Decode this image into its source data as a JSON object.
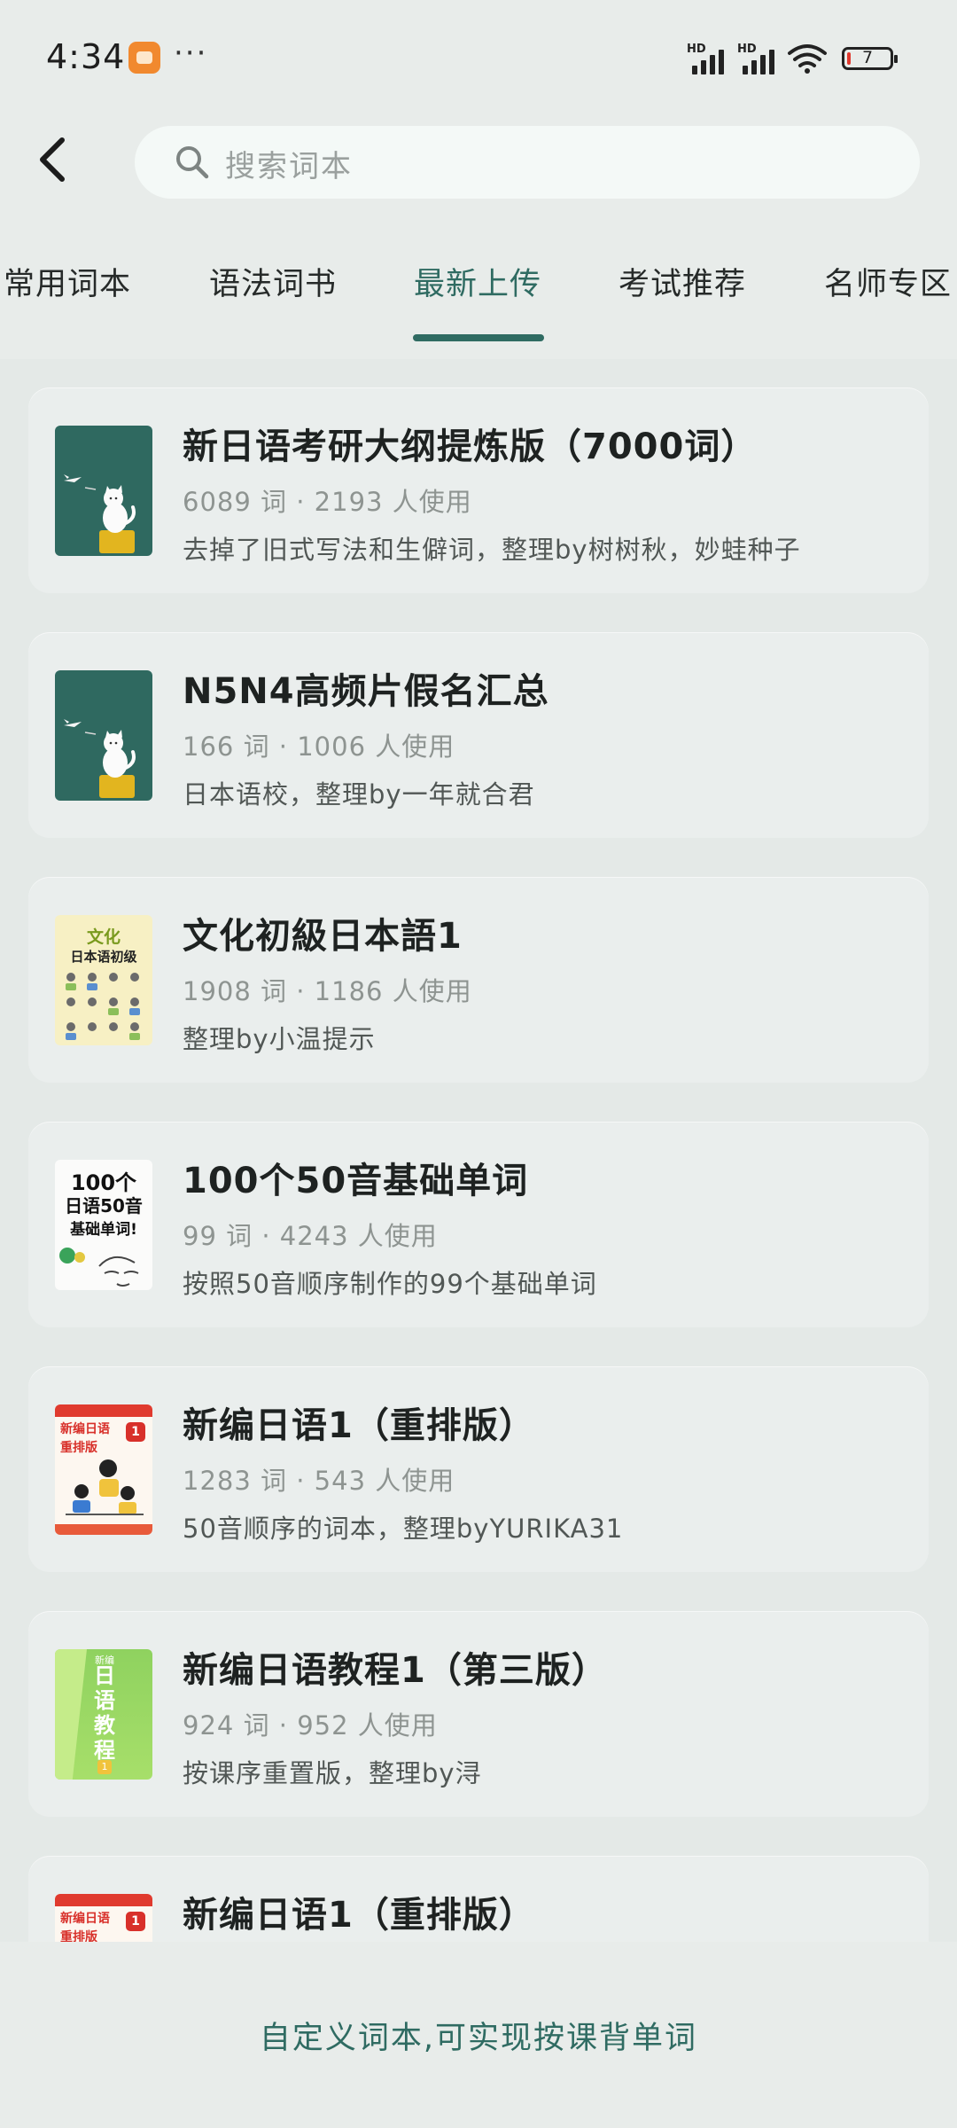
{
  "status_bar": {
    "time": "4:34",
    "more": "···",
    "signal_1_label": "HD",
    "signal_2_label": "HD",
    "battery_level": "7",
    "colors": {
      "app_icon": "#f1892f",
      "battery_low": "#e0392e"
    }
  },
  "header": {
    "search_placeholder": "搜索词本"
  },
  "tabs": [
    {
      "label": "常用词本",
      "active": false
    },
    {
      "label": "语法词书",
      "active": false
    },
    {
      "label": "最新上传",
      "active": true
    },
    {
      "label": "考试推荐",
      "active": false
    },
    {
      "label": "名师专区",
      "active": false
    }
  ],
  "books": [
    {
      "title": "新日语考研大纲提炼版（7000词）",
      "stats": "6089 词 · 2193 人使用",
      "desc": "去掉了旧式写法和生僻词，整理by树树秋，妙蛙种子",
      "cover": "cat-green"
    },
    {
      "title": "N5N4高频片假名汇总",
      "stats": "166 词 · 1006 人使用",
      "desc": "日本语校，整理by一年就合君",
      "cover": "cat-green"
    },
    {
      "title": "文化初級日本語1",
      "stats": "1908 词 · 1186 人使用",
      "desc": "整理by小温提示",
      "cover": "bunka-yellow",
      "cover_text": [
        "文化",
        "日本语初级"
      ]
    },
    {
      "title": "100个50音基础单词",
      "stats": "99 词 · 4243 人使用",
      "desc": "按照50音顺序制作的99个基础单词",
      "cover": "hundred-words",
      "cover_text": [
        "100个",
        "日语50音",
        "基础单词!"
      ]
    },
    {
      "title": "新编日语1（重排版）",
      "stats": "1283 词 · 543 人使用",
      "desc": "50音顺序的词本，整理byYURIKA31",
      "cover": "shinpen-red",
      "cover_text": [
        "新编日语",
        "重排版",
        "1"
      ]
    },
    {
      "title": "新编日语教程1（第三版）",
      "stats": "924 词 · 952 人使用",
      "desc": "按课序重置版，整理by浔",
      "cover": "kyoutei-green",
      "cover_text": [
        "新编",
        "日语教程",
        "1"
      ]
    },
    {
      "title": "新编日语1（重排版）",
      "stats": "",
      "desc": "",
      "cover": "shinpen-red",
      "cover_text": [
        "新编日语",
        "重排版",
        "1"
      ]
    }
  ],
  "bottom": {
    "link_text": "自定义词本,可实现按课背单词"
  },
  "theme": {
    "accent": "#2f6b62",
    "background": "#e8ecea",
    "card": "#eaeeed"
  }
}
